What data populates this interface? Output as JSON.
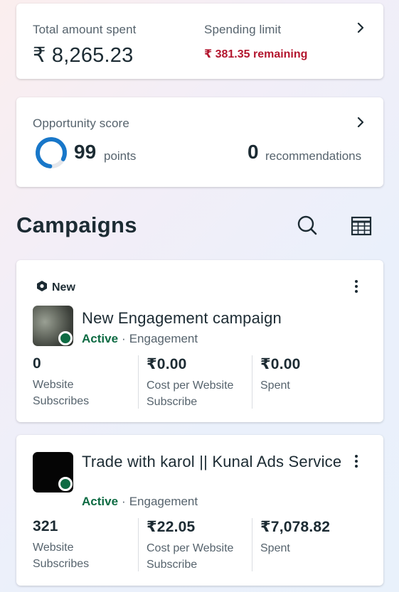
{
  "spend": {
    "total_label": "Total amount spent",
    "total_value": "₹ 8,265.23",
    "limit_label": "Spending limit",
    "limit_value": "₹ 381.35 remaining"
  },
  "opportunity": {
    "label": "Opportunity score",
    "points_value": "99",
    "points_unit": "points",
    "points_fraction": 0.99,
    "recommendations_value": "0",
    "recommendations_unit": "recommendations"
  },
  "campaigns": {
    "title": "Campaigns",
    "items": [
      {
        "badge": "New",
        "name": "New Engagement campaign",
        "status": "Active",
        "separator": "·",
        "objective": "Engagement",
        "metrics": [
          {
            "value": "0",
            "label": "Website Subscribes"
          },
          {
            "value": "₹0.00",
            "label": "Cost per Website Subscribe"
          },
          {
            "value": "₹0.00",
            "label": "Spent"
          }
        ]
      },
      {
        "name": "Trade with karol || Kunal Ads Service",
        "status": "Active",
        "separator": "·",
        "objective": "Engagement",
        "metrics": [
          {
            "value": "321",
            "label": "Website Subscribes"
          },
          {
            "value": "₹22.05",
            "label": "Cost per Website Subscribe"
          },
          {
            "value": "₹7,078.82",
            "label": "Spent"
          }
        ]
      }
    ]
  },
  "icons": {
    "chevron": "chevron-right-icon",
    "search": "search-icon",
    "table": "table-view-icon",
    "more": "more-vertical-icon",
    "new": "hexagon-badge-icon"
  },
  "colors": {
    "active_green": "#0e6b43",
    "limit_red": "#b3162e",
    "ring_blue": "#1877c9",
    "text_dark": "#1c2b33"
  }
}
